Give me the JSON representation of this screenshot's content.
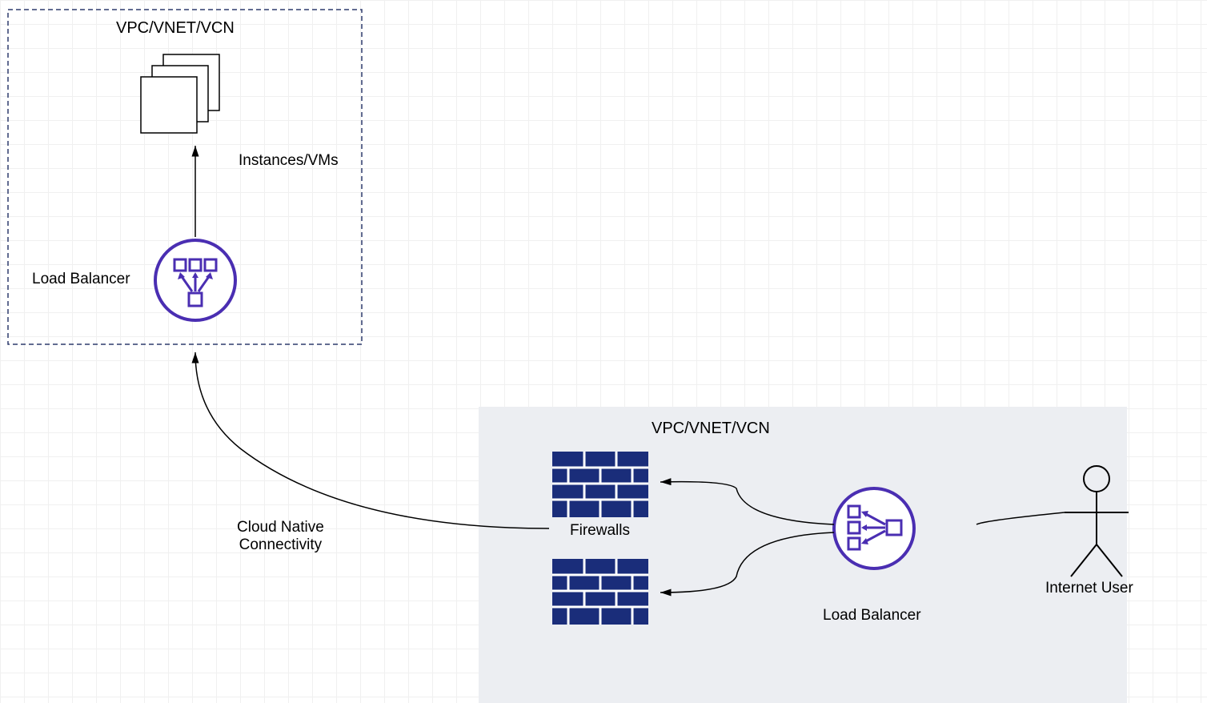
{
  "vpc_box_left": {
    "title": "VPC/VNET/VCN"
  },
  "vpc_box_right": {
    "title": "VPC/VNET/VCN"
  },
  "nodes": {
    "instances": {
      "label": "Instances/VMs"
    },
    "load_balancer_left": {
      "label": "Load Balancer"
    },
    "load_balancer_right": {
      "label": "Load Balancer"
    },
    "firewalls": {
      "label": "Firewalls"
    },
    "internet_user": {
      "label": "Internet User"
    }
  },
  "edges": {
    "cloud_native": {
      "label_line1": "Cloud Native",
      "label_line2": "Connectivity"
    }
  },
  "colors": {
    "purple": "#4a2eb2",
    "darkblue": "#1a2d7a",
    "navy": "#2f3c6d",
    "grey": "#eceef2"
  }
}
